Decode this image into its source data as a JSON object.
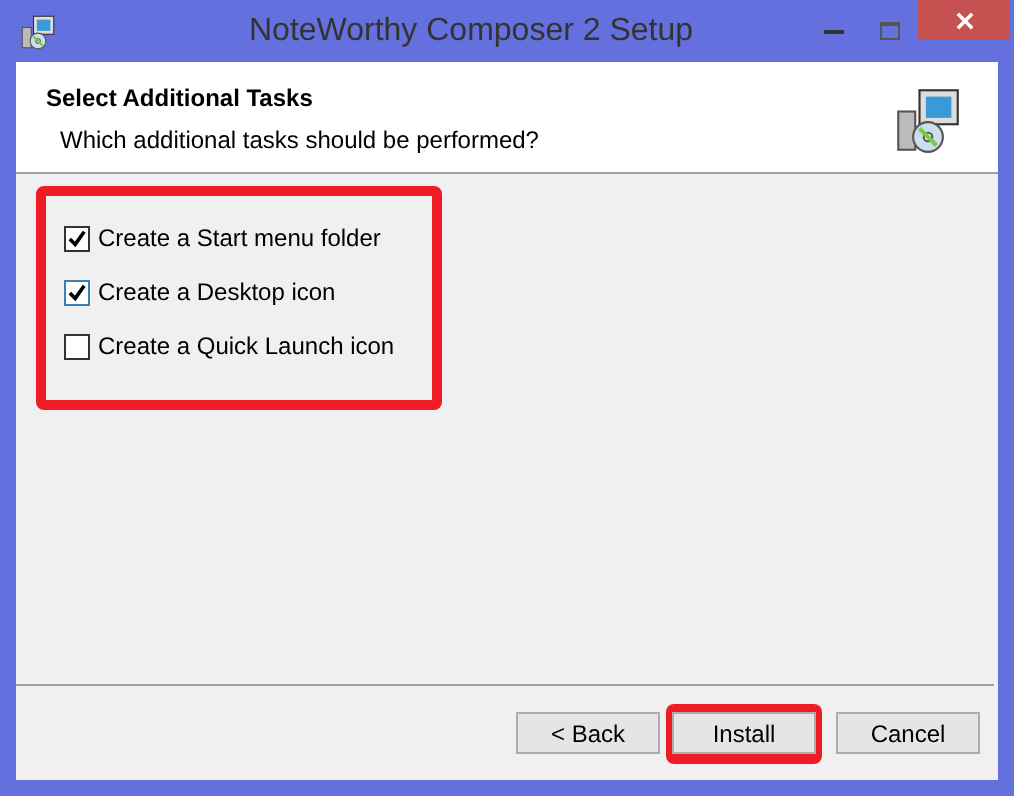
{
  "window": {
    "title": "NoteWorthy Composer 2 Setup"
  },
  "header": {
    "title": "Select Additional Tasks",
    "subtitle": "Which additional tasks should be performed?"
  },
  "task_group": {
    "highlighted": true
  },
  "tasks": [
    {
      "label": "Create a Start menu folder",
      "checked": true
    },
    {
      "label": "Create a Desktop icon",
      "checked": true
    },
    {
      "label": "Create a Quick Launch icon",
      "checked": false
    }
  ],
  "buttons": [
    {
      "label": "< Back",
      "highlighted": false
    },
    {
      "label": "Install",
      "highlighted": true
    },
    {
      "label": "Cancel",
      "highlighted": false
    }
  ]
}
